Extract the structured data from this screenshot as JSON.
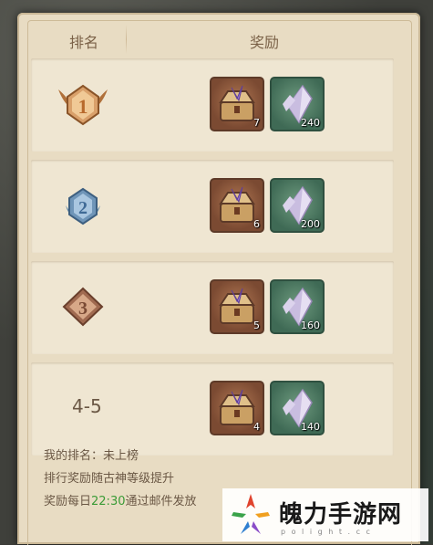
{
  "header": {
    "rank_label": "排名",
    "reward_label": "奖励"
  },
  "rows": [
    {
      "rank": "1",
      "rank_display": "medal",
      "medal_color": "#c9864a",
      "items": [
        {
          "type": "chest",
          "count": "7"
        },
        {
          "type": "crystal",
          "count": "240"
        }
      ]
    },
    {
      "rank": "2",
      "rank_display": "medal",
      "medal_color": "#5f86a8",
      "items": [
        {
          "type": "chest",
          "count": "6"
        },
        {
          "type": "crystal",
          "count": "200"
        }
      ]
    },
    {
      "rank": "3",
      "rank_display": "medal",
      "medal_color": "#a06a50",
      "items": [
        {
          "type": "chest",
          "count": "5"
        },
        {
          "type": "crystal",
          "count": "160"
        }
      ]
    },
    {
      "rank": "4-5",
      "rank_display": "text",
      "items": [
        {
          "type": "chest",
          "count": "4"
        },
        {
          "type": "crystal",
          "count": "140"
        }
      ]
    }
  ],
  "footer": {
    "my_rank": "我的排名：未上榜",
    "rule": "排行奖励随古神等级提升",
    "time_prefix": "奖励每日",
    "time": "22:30",
    "time_suffix": "通过邮件发放"
  },
  "watermark": {
    "text": "魄力手游网",
    "sub": "p o l i g h t . c c"
  },
  "colors": {
    "panel": "#e8dcc3",
    "row": "#efe6d2",
    "text": "#6b5845",
    "accent_time": "#3a9b36"
  }
}
